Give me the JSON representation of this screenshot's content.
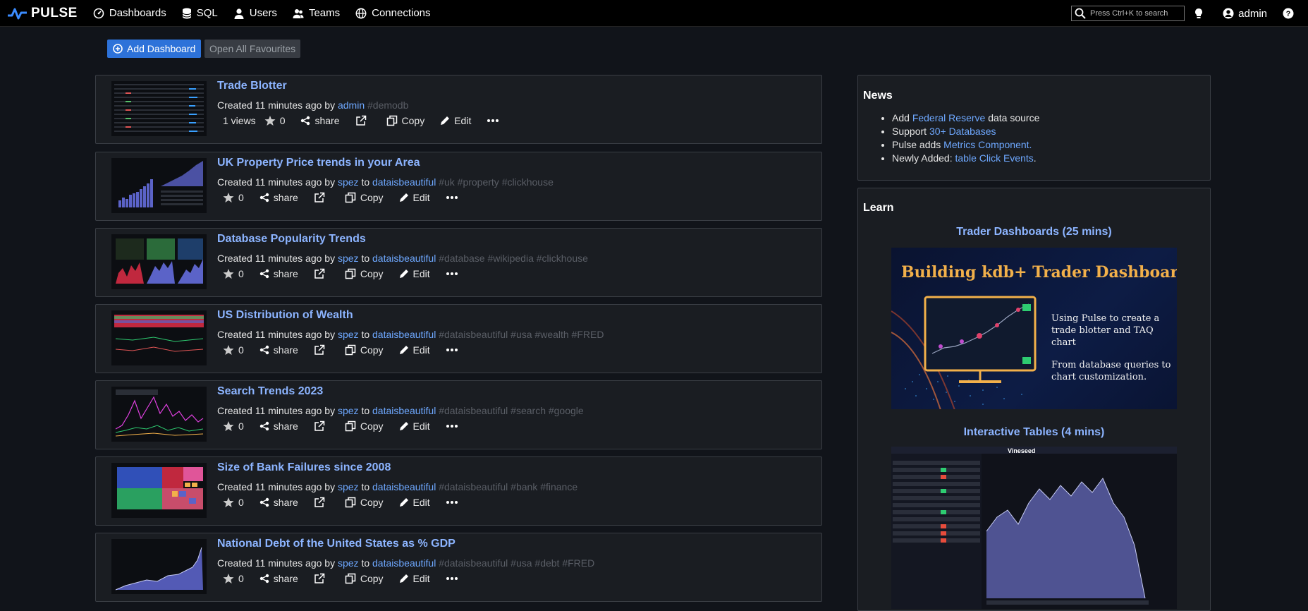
{
  "app": {
    "brand": "PULSE"
  },
  "nav": {
    "items": [
      {
        "label": "Dashboards",
        "icon": "dashboard-icon"
      },
      {
        "label": "SQL",
        "icon": "database-icon"
      },
      {
        "label": "Users",
        "icon": "user-icon"
      },
      {
        "label": "Teams",
        "icon": "team-icon"
      },
      {
        "label": "Connections",
        "icon": "globe-icon"
      }
    ]
  },
  "search": {
    "placeholder": "Press Ctrl+K to search"
  },
  "user": {
    "name": "admin"
  },
  "toolbar": {
    "add_label": "Add Dashboard",
    "favourites_label": "Open All Favourites"
  },
  "dashboards": [
    {
      "title": "Trade Blotter",
      "created": "Created 11 minutes ago by",
      "author": "admin",
      "to": "",
      "team": "",
      "tags": "#demodb",
      "views": "1 views",
      "stars": "0"
    },
    {
      "title": "UK Property Price trends in your Area",
      "created": "Created 11 minutes ago by",
      "author": "spez",
      "to": "to",
      "team": "dataisbeautiful",
      "tags": "#uk #property #clickhouse",
      "views": "",
      "stars": "0"
    },
    {
      "title": "Database Popularity Trends",
      "created": "Created 11 minutes ago by",
      "author": "spez",
      "to": "to",
      "team": "dataisbeautiful",
      "tags": "#database #wikipedia #clickhouse",
      "views": "",
      "stars": "0"
    },
    {
      "title": "US Distribution of Wealth",
      "created": "Created 11 minutes ago by",
      "author": "spez",
      "to": "to",
      "team": "dataisbeautiful",
      "tags": "#dataisbeautiful #usa #wealth #FRED",
      "views": "",
      "stars": "0"
    },
    {
      "title": "Search Trends 2023",
      "created": "Created 11 minutes ago by",
      "author": "spez",
      "to": "to",
      "team": "dataisbeautiful",
      "tags": "#dataisbeautiful #search #google",
      "views": "",
      "stars": "0"
    },
    {
      "title": "Size of Bank Failures since 2008",
      "created": "Created 11 minutes ago by",
      "author": "spez",
      "to": "to",
      "team": "dataisbeautiful",
      "tags": "#dataisbeautiful #bank #finance",
      "views": "",
      "stars": "0"
    },
    {
      "title": "National Debt of the United States as % GDP",
      "created": "Created 11 minutes ago by",
      "author": "spez",
      "to": "to",
      "team": "dataisbeautiful",
      "tags": "#dataisbeautiful #usa #debt #FRED",
      "views": "",
      "stars": "0"
    }
  ],
  "actions": {
    "share": "share",
    "copy": "Copy",
    "edit": "Edit"
  },
  "news": {
    "title": "News",
    "items": [
      {
        "pre": "Add ",
        "link": "Federal Reserve",
        "post": " data source"
      },
      {
        "pre": "Support ",
        "link": "30+ Databases",
        "post": ""
      },
      {
        "pre": "Pulse adds ",
        "link": "Metrics Component.",
        "post": ""
      },
      {
        "pre": "Newly Added: ",
        "link": "table Click Events",
        "post": "."
      }
    ]
  },
  "learn": {
    "title": "Learn",
    "video1": "Trader Dashboards (25 mins)",
    "poster_title": "Building kdb+ Trader Dashboards",
    "poster_text1": "Using Pulse to create a trade blotter and TAQ chart",
    "poster_text2": "From database queries to chart customization.",
    "video2": "Interactive Tables (4 mins)",
    "shot_title": "Vineseed"
  },
  "colors": {
    "accent": "#2d72d9",
    "link": "#6ea8ff",
    "title": "#8cb4ff",
    "background": "#11141a",
    "card": "#1a1d22"
  }
}
